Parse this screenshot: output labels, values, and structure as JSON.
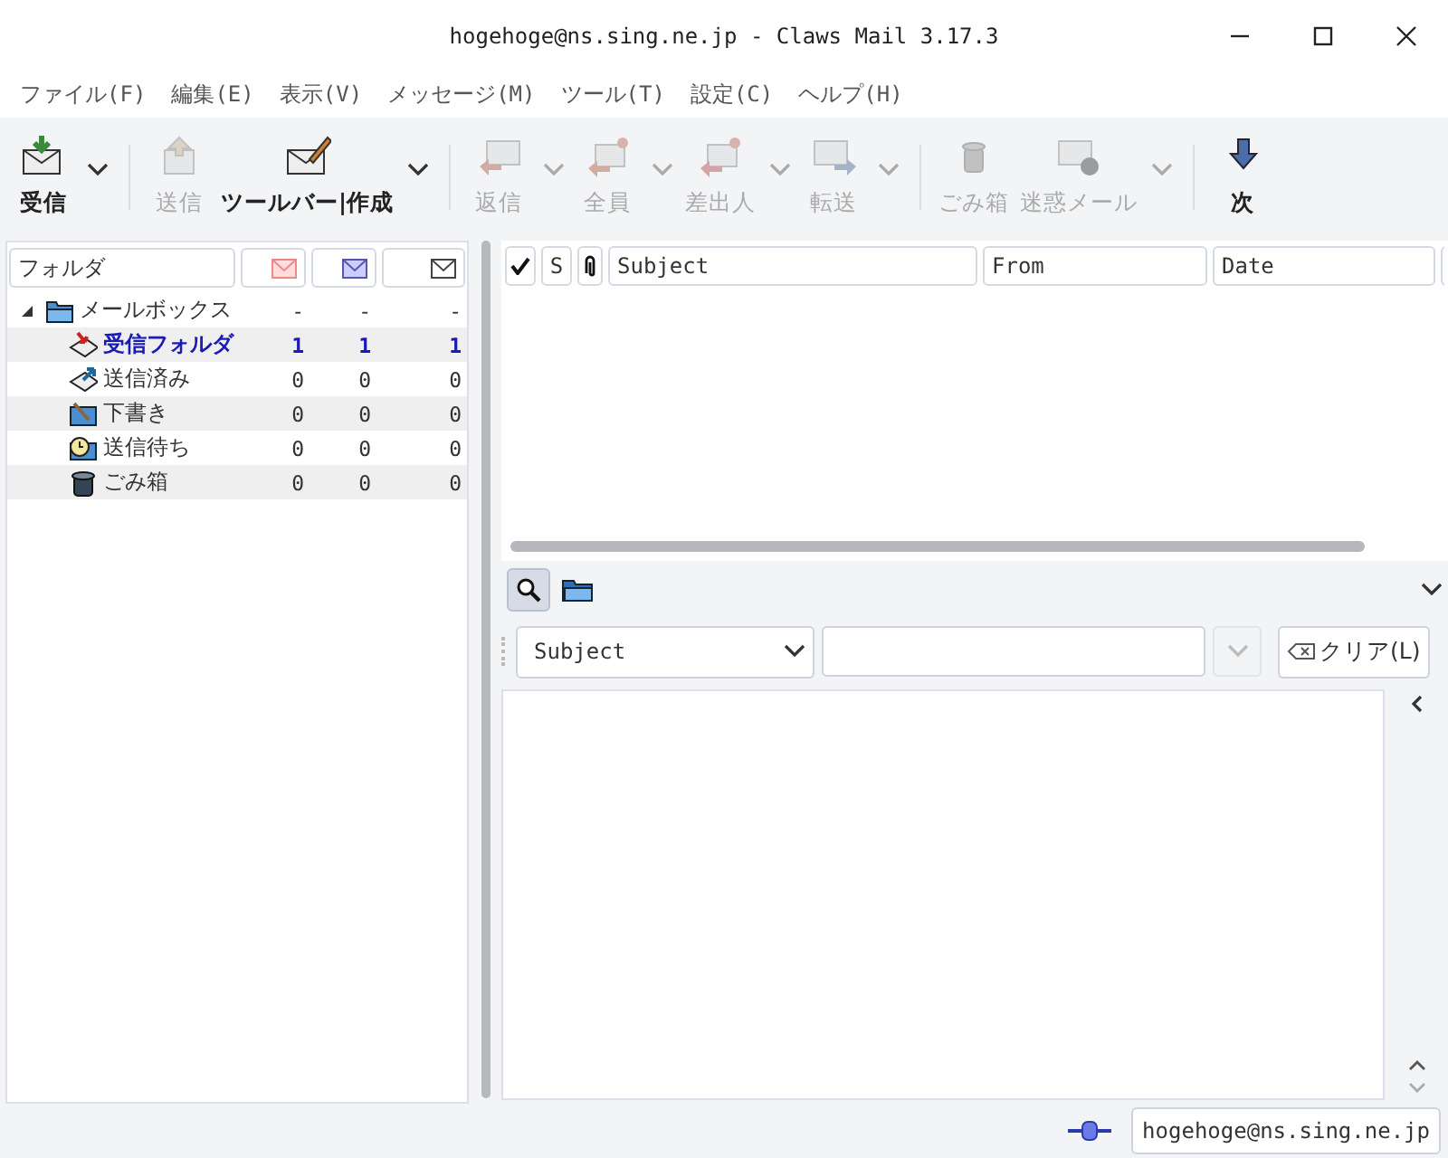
{
  "window": {
    "title": "hogehoge@ns.sing.ne.jp - Claws Mail 3.17.3"
  },
  "menu": [
    "ファイル(F)",
    "編集(E)",
    "表示(V)",
    "メッセージ(M)",
    "ツール(T)",
    "設定(C)",
    "ヘルプ(H)"
  ],
  "toolbar": [
    {
      "kind": "button",
      "label": "受信",
      "disabled": false,
      "has_menu": true
    },
    {
      "kind": "separator"
    },
    {
      "kind": "button",
      "label": "送信",
      "disabled": true,
      "has_menu": false
    },
    {
      "kind": "button",
      "label": "ツールバー|作成",
      "disabled": false,
      "has_menu": true
    },
    {
      "kind": "separator"
    },
    {
      "kind": "button",
      "label": "返信",
      "disabled": true,
      "has_menu": true
    },
    {
      "kind": "button",
      "label": "全員",
      "disabled": true,
      "has_menu": true
    },
    {
      "kind": "button",
      "label": "差出人",
      "disabled": true,
      "has_menu": true
    },
    {
      "kind": "button",
      "label": "転送",
      "disabled": true,
      "has_menu": true
    },
    {
      "kind": "separator"
    },
    {
      "kind": "button",
      "label": "ごみ箱",
      "disabled": true,
      "has_menu": false
    },
    {
      "kind": "button",
      "label": "迷惑メール",
      "disabled": true,
      "has_menu": true
    },
    {
      "kind": "separator"
    },
    {
      "kind": "button",
      "label": "次",
      "disabled": false,
      "has_menu": false
    }
  ],
  "folder_pane": {
    "columns": [
      "フォルダ"
    ],
    "folders": [
      {
        "kind": "mailbox",
        "name": "メールボックス",
        "expanded": true,
        "unread": false,
        "new_count": "-",
        "unread_count": "-",
        "total": "-",
        "children": [
          {
            "kind": "inbox",
            "name": "受信フォルダ",
            "unread": true,
            "new_count": "1",
            "unread_count": "1",
            "total": "1"
          },
          {
            "kind": "sent",
            "name": "送信済み",
            "unread": false,
            "new_count": "0",
            "unread_count": "0",
            "total": "0"
          },
          {
            "kind": "draft",
            "name": "下書き",
            "unread": false,
            "new_count": "0",
            "unread_count": "0",
            "total": "0"
          },
          {
            "kind": "queue",
            "name": "送信待ち",
            "unread": false,
            "new_count": "0",
            "unread_count": "0",
            "total": "0"
          },
          {
            "kind": "trash",
            "name": "ごみ箱",
            "unread": false,
            "new_count": "0",
            "unread_count": "0",
            "total": "0"
          }
        ]
      }
    ]
  },
  "message_list": {
    "columns": [
      {
        "kind": "check"
      },
      {
        "kind": "text",
        "label": "S"
      },
      {
        "kind": "clip"
      },
      {
        "kind": "text",
        "label": "Subject"
      },
      {
        "kind": "text",
        "label": "From"
      },
      {
        "kind": "text",
        "label": "Date"
      },
      {
        "kind": "cut"
      }
    ]
  },
  "quick_search": {
    "search_active": true,
    "field": "Subject",
    "clear_button": "クリア(L)"
  },
  "status_bar": {
    "account": "hogehoge@ns.sing.ne.jp"
  }
}
